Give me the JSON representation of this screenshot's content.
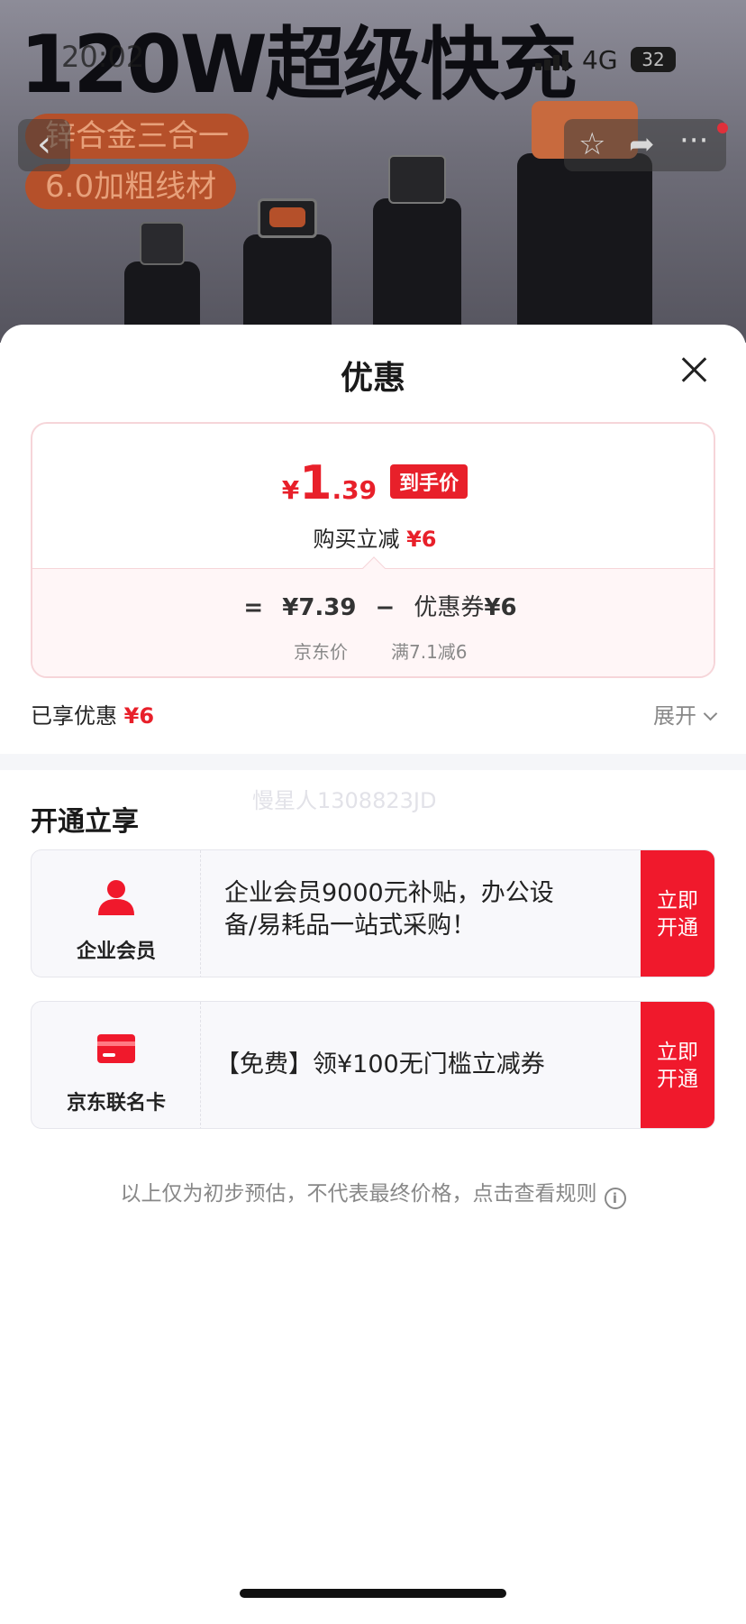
{
  "status_bar": {
    "time": "20:02",
    "network": "4G",
    "battery": "32"
  },
  "background": {
    "banner_title": "120W超级快充",
    "tag1": "锌合金三合一",
    "tag2": "6.0加粗线材"
  },
  "nav": {
    "back_icon": "back-chevron-icon",
    "star_icon": "star-icon",
    "share_icon": "share-icon",
    "more_icon": "more-icon"
  },
  "sheet": {
    "title": "优惠",
    "close_icon": "close-icon",
    "price": {
      "yen": "¥",
      "integer": "1",
      "decimal": ".39",
      "badge": "到手价",
      "buy_label": "购买立减",
      "buy_discount": "¥6",
      "equals": "=",
      "jd_price": "¥7.39",
      "minus": "−",
      "coupon_label": "优惠券",
      "coupon_value": "¥6",
      "jd_price_label": "京东价",
      "coupon_rule": "满7.1减6"
    },
    "enjoyed_label": "已享优惠",
    "enjoyed_value": "¥6",
    "expand_label": "展开",
    "watermark": "慢星人1308823JD",
    "section_title": "开通立享",
    "offers": [
      {
        "name": "企业会员",
        "icon": "person-icon",
        "text": "企业会员9000元补贴，办公设备/易耗品一站式采购！",
        "button": "立即开通"
      },
      {
        "name": "京东联名卡",
        "icon": "credit-card-icon",
        "text": "【免费】领¥100无门槛立减券",
        "button": "立即开通"
      }
    ],
    "footnote": "以上仅为初步预估，不代表最终价格，点击查看规则",
    "footnote_icon": "info-icon"
  },
  "colors": {
    "accent_red": "#e8202a",
    "button_red": "#f0192c",
    "card_border": "#f6d5d9"
  }
}
